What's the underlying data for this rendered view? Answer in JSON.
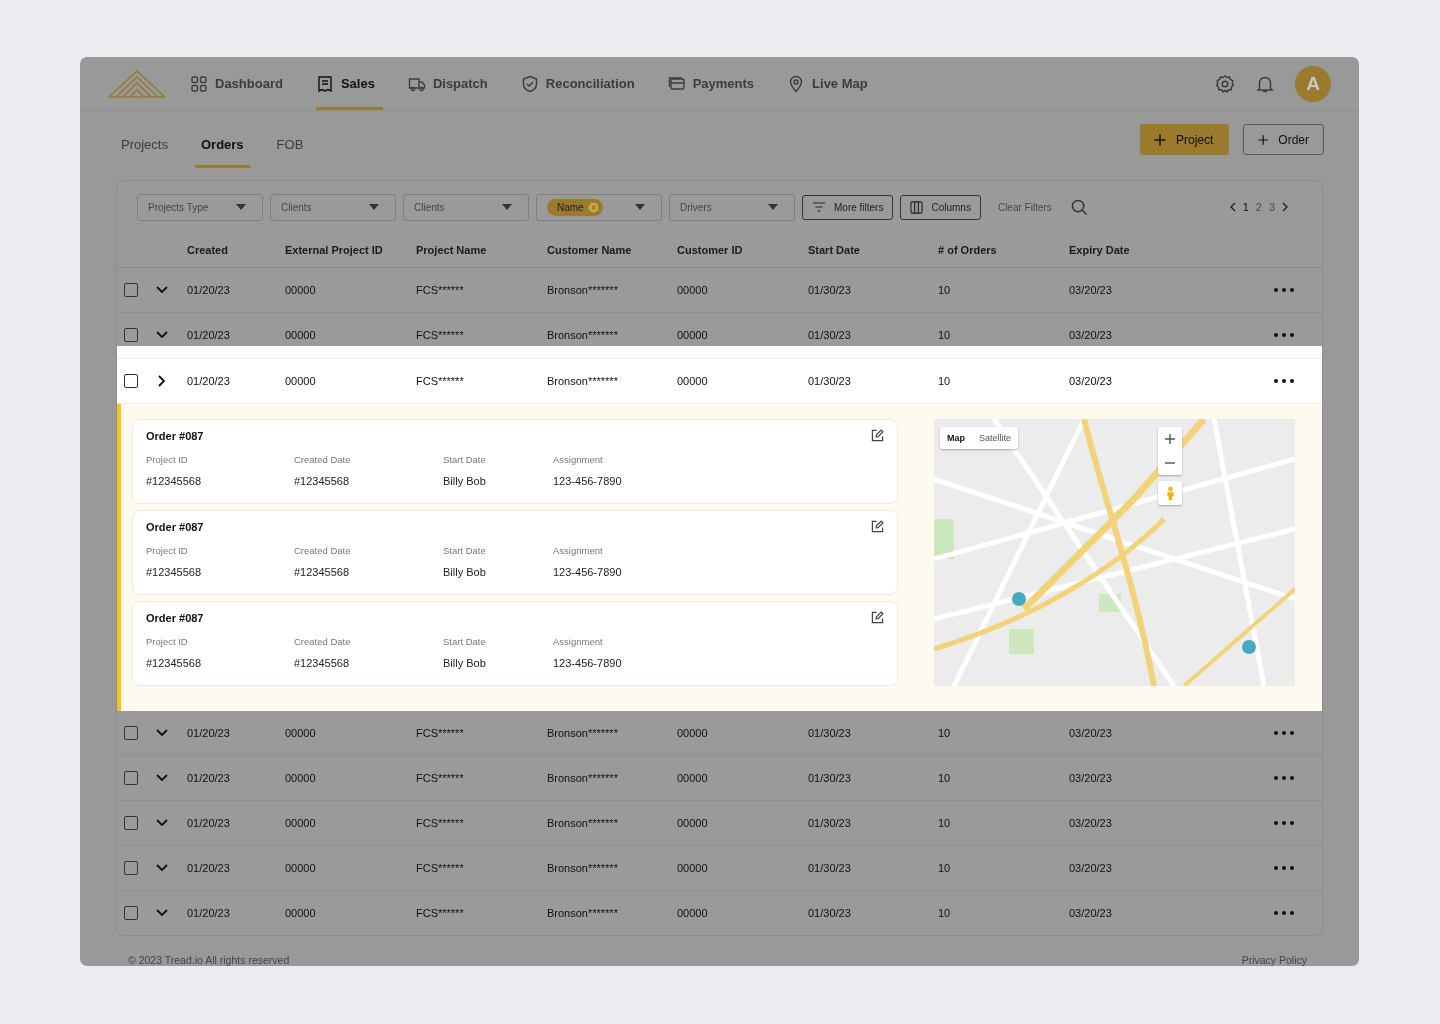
{
  "nav": [
    {
      "label": "Dashboard",
      "selected": false
    },
    {
      "label": "Sales",
      "selected": true
    },
    {
      "label": "Dispatch",
      "selected": false
    },
    {
      "label": "Reconciliation",
      "selected": false
    },
    {
      "label": "Payments",
      "selected": false
    },
    {
      "label": "Live Map",
      "selected": false
    }
  ],
  "avatar": "A",
  "subtabs": [
    {
      "label": "Projects",
      "selected": false
    },
    {
      "label": "Orders",
      "selected": true
    },
    {
      "label": "FOB",
      "selected": false
    }
  ],
  "buttons": [
    {
      "label": "Project",
      "kind": "primary"
    },
    {
      "label": "Order",
      "kind": "outline"
    }
  ],
  "filters": [
    {
      "label": "Projects Type",
      "kind": "placeholder"
    },
    {
      "label": "Clients",
      "kind": "placeholder"
    },
    {
      "label": "Clients",
      "kind": "placeholder"
    },
    {
      "label": "Name",
      "kind": "chip"
    },
    {
      "label": "Drivers",
      "kind": "placeholder"
    }
  ],
  "filter_buttons": [
    "More filters",
    "Columns"
  ],
  "clear_filters": "Clear Filters",
  "pagination": [
    {
      "label": "1",
      "selected": true
    },
    {
      "label": "2",
      "selected": false
    },
    {
      "label": "3",
      "selected": false
    }
  ],
  "table": {
    "columns": [
      "Created",
      "External Project ID",
      "Project Name",
      "Customer Name",
      "Customer ID",
      "Start Date",
      "# of Orders",
      "Expiry Date"
    ],
    "rows": [
      {
        "checked": false,
        "expanded": false,
        "cells": [
          "01/20/23",
          "00000",
          "FCS******",
          "Bronson*******",
          "00000",
          "01/30/23",
          "10",
          "03/20/23"
        ]
      },
      {
        "checked": false,
        "expanded": false,
        "cells": [
          "01/20/23",
          "00000",
          "FCS******",
          "Bronson*******",
          "00000",
          "01/30/23",
          "10",
          "03/20/23"
        ]
      },
      {
        "checked": false,
        "expanded": true,
        "cells": [
          "01/20/23",
          "00000",
          "FCS******",
          "Bronson*******",
          "00000",
          "01/30/23",
          "10",
          "03/20/23"
        ],
        "orders": [
          {
            "title": "Order #087",
            "fields": [
              {
                "label": "Project ID",
                "value": "#12345568"
              },
              {
                "label": "Created Date",
                "value": "#12345568"
              },
              {
                "label": "Start Date",
                "value": "Billy Bob"
              },
              {
                "label": "Assignment",
                "value": "123-456-7890"
              }
            ]
          },
          {
            "title": "Order #087",
            "fields": [
              {
                "label": "Project ID",
                "value": "#12345568"
              },
              {
                "label": "Created Date",
                "value": "#12345568"
              },
              {
                "label": "Start Date",
                "value": "Billy Bob"
              },
              {
                "label": "Assignment",
                "value": "123-456-7890"
              }
            ]
          },
          {
            "title": "Order #087",
            "fields": [
              {
                "label": "Project ID",
                "value": "#12345568"
              },
              {
                "label": "Created Date",
                "value": "#12345568"
              },
              {
                "label": "Start Date",
                "value": "Billy Bob"
              },
              {
                "label": "Assignment",
                "value": "123-456-7890"
              }
            ]
          }
        ],
        "map": {
          "kind": "picture",
          "types": [
            {
              "label": "Map",
              "selected": true
            },
            {
              "label": "Satellite",
              "selected": false
            }
          ]
        }
      },
      {
        "checked": false,
        "expanded": false,
        "cells": [
          "01/20/23",
          "00000",
          "FCS******",
          "Bronson*******",
          "00000",
          "01/30/23",
          "10",
          "03/20/23"
        ]
      },
      {
        "checked": false,
        "expanded": false,
        "cells": [
          "01/20/23",
          "00000",
          "FCS******",
          "Bronson*******",
          "00000",
          "01/30/23",
          "10",
          "03/20/23"
        ]
      },
      {
        "checked": false,
        "expanded": false,
        "cells": [
          "01/20/23",
          "00000",
          "FCS******",
          "Bronson*******",
          "00000",
          "01/30/23",
          "10",
          "03/20/23"
        ]
      },
      {
        "checked": false,
        "expanded": false,
        "cells": [
          "01/20/23",
          "00000",
          "FCS******",
          "Bronson*******",
          "00000",
          "01/30/23",
          "10",
          "03/20/23"
        ]
      },
      {
        "checked": false,
        "expanded": false,
        "cells": [
          "01/20/23",
          "00000",
          "FCS******",
          "Bronson*******",
          "00000",
          "01/30/23",
          "10",
          "03/20/23"
        ]
      }
    ]
  },
  "footer": {
    "copyright": "© 2023 Tread.io All rights reserved",
    "privacy": "Privacy Policy"
  }
}
